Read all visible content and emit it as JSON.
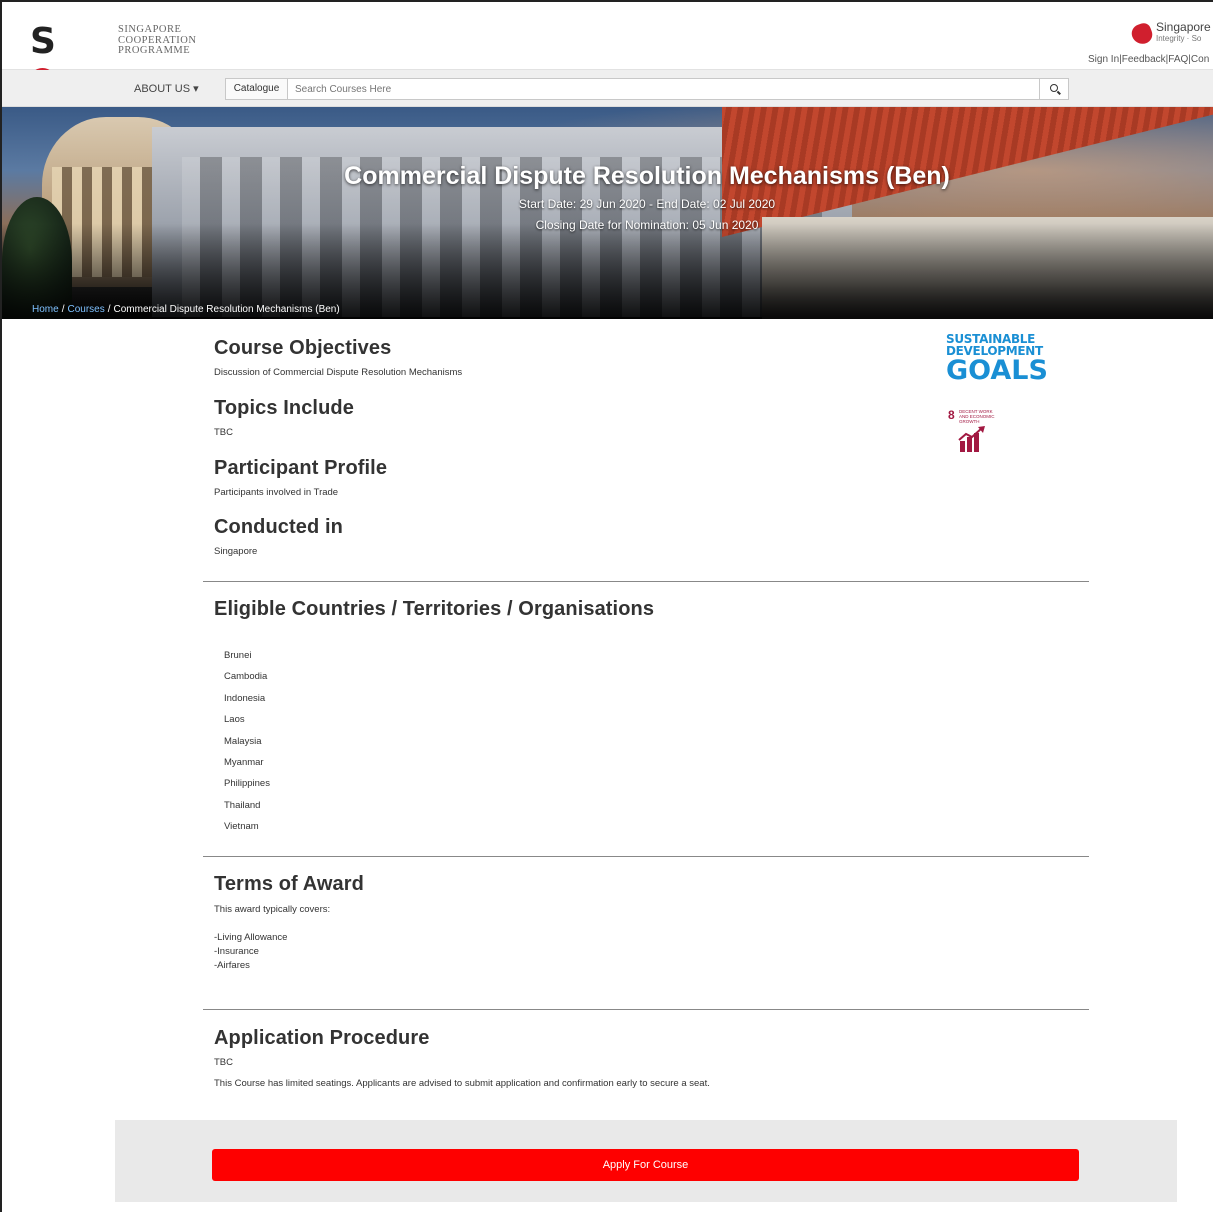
{
  "header": {
    "logo_mark_left": "S",
    "logo_mark_right": "P",
    "logo_line1": "SINGAPORE",
    "logo_line2": "COOPERATION",
    "logo_line3": "PROGRAMME",
    "brand_name": "Singapore",
    "brand_tagline": "Integrity · So",
    "links": {
      "sign_in": "Sign In",
      "feedback": "Feedback",
      "faq": "FAQ",
      "contact": "Con",
      "separator": "|"
    }
  },
  "nav": {
    "about": "ABOUT US",
    "about_caret": "▾",
    "catalogue": "Catalogue",
    "search_placeholder": "Search Courses Here"
  },
  "hero": {
    "title": "Commercial Dispute Resolution Mechanisms (Ben)",
    "dates": "Start Date: 29 Jun 2020 - End Date: 02 Jul 2020",
    "closing": "Closing Date for Nomination: 05 Jun 2020"
  },
  "breadcrumb": {
    "home": "Home",
    "courses": "Courses",
    "current": "Commercial Dispute Resolution Mechanisms (Ben)",
    "separator": "/"
  },
  "sections": {
    "objectives_title": "Course Objectives",
    "objectives_text": "Discussion of Commercial Dispute Resolution Mechanisms",
    "topics_title": "Topics Include",
    "topics_text": "TBC",
    "profile_title": "Participant Profile",
    "profile_text": "Participants involved in Trade",
    "conducted_title": "Conducted in",
    "conducted_text": "Singapore",
    "eligible_title": "Eligible Countries / Territories / Organisations",
    "countries": [
      "Brunei",
      "Cambodia",
      "Indonesia",
      "Laos",
      "Malaysia",
      "Myanmar",
      "Philippines",
      "Thailand",
      "Vietnam"
    ],
    "award_title": "Terms of Award",
    "award_intro": "This award typically covers:",
    "award_items": [
      "-Living Allowance",
      "-Insurance",
      "-Airfares"
    ],
    "procedure_title": "Application Procedure",
    "procedure_text": "TBC",
    "procedure_note": "This Course has limited seatings. Applicants are advised to submit application and confirmation early to secure a seat."
  },
  "sdg": {
    "line1": "SUSTAINABLE",
    "line2": "DEVELOPMENT",
    "line3": "GOALS",
    "goal_number": "8",
    "goal_text": "DECENT WORK AND ECONOMIC GROWTH",
    "blue": "#1a8fd4",
    "goal_color": "#a21942"
  },
  "apply": {
    "label": "Apply For Course",
    "color": "#fe0000"
  }
}
